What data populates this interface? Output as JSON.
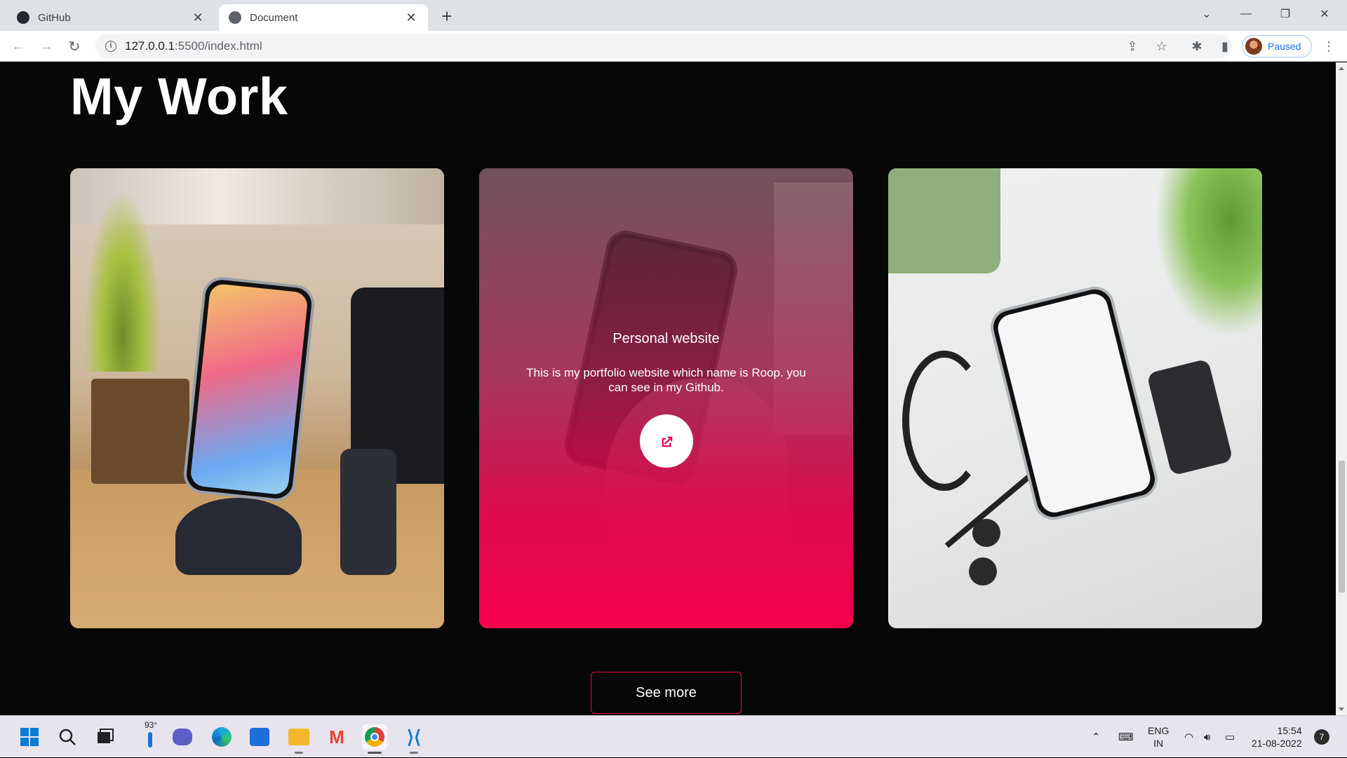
{
  "browser": {
    "tabs": [
      {
        "title": "GitHub",
        "favicon": "github-icon",
        "active": false
      },
      {
        "title": "Document",
        "favicon": "globe-icon",
        "active": true
      }
    ],
    "new_tab_label": "+",
    "url_host": "127.0.0.1",
    "url_rest": ":5500/index.html",
    "profile_status": "Paused"
  },
  "page": {
    "heading": "My Work",
    "cards": [
      {
        "image": "phone-on-stand-photo",
        "has_overlay": false
      },
      {
        "image": "phone-in-hand-photo",
        "has_overlay": true,
        "overlay_title": "Personal website",
        "overlay_description": "This is my portfolio website which name is Roop. you can see in my Github.",
        "overlay_button_icon": "external-link-icon"
      },
      {
        "image": "store-app-phone-photo",
        "has_overlay": false
      }
    ],
    "see_more_label": "See more",
    "accent_color": "#f5004c"
  },
  "taskbar": {
    "apps": [
      "windows-start-icon",
      "search-icon",
      "task-view-icon",
      "weather-icon",
      "chat-icon",
      "edge-icon",
      "store-icon",
      "file-explorer-icon",
      "gmail-icon",
      "chrome-icon",
      "vscode-icon"
    ],
    "weather_temp": "93°",
    "language_line1": "ENG",
    "language_line2": "IN",
    "time": "15:54",
    "date": "21-08-2022",
    "notification_count": "7"
  }
}
